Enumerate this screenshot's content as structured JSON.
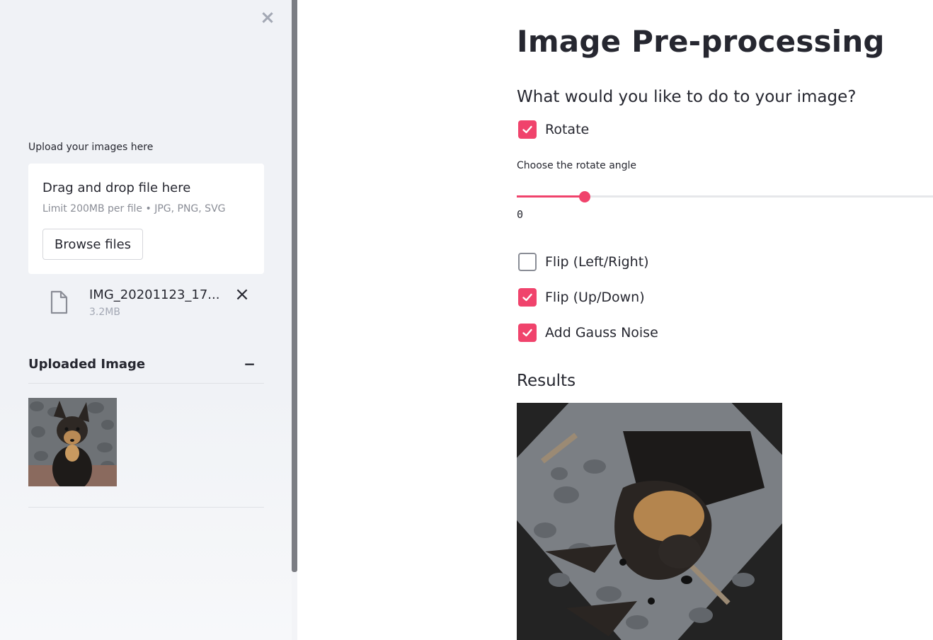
{
  "sidebar": {
    "upload_label": "Upload your images here",
    "dropzone": {
      "title": "Drag and drop file here",
      "limit": "Limit 200MB per file • JPG, PNG, SVG",
      "browse_label": "Browse files"
    },
    "file": {
      "name": "IMG_20201123_17...",
      "size": "3.2MB"
    },
    "expander": {
      "title": "Uploaded Image",
      "toggle": "−"
    }
  },
  "main": {
    "title": "Image Pre-processing",
    "question": "What would you like to do to your image?",
    "options": [
      {
        "label": "Rotate",
        "checked": true
      },
      {
        "label": "Flip (Left/Right)",
        "checked": false
      },
      {
        "label": "Flip (Up/Down)",
        "checked": true
      },
      {
        "label": "Add Gauss Noise",
        "checked": true
      }
    ],
    "slider": {
      "label": "Choose the rotate angle",
      "value": "0"
    },
    "results_title": "Results"
  },
  "colors": {
    "accent": "#f0436c",
    "sidebar_bg": "#f0f2f6",
    "text": "#262730"
  }
}
